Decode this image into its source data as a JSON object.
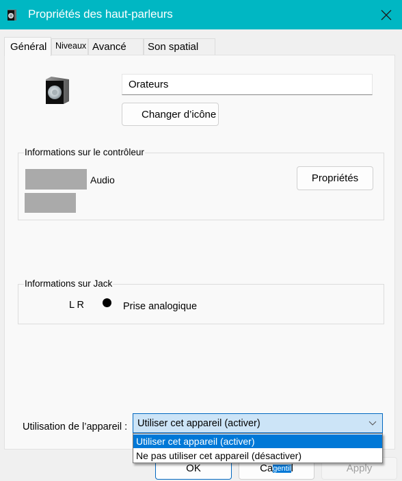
{
  "window": {
    "title": "Propriétés des haut-parleurs",
    "accent_color": "#00b7c3"
  },
  "tabs": [
    {
      "label": "Général",
      "active": true
    },
    {
      "label": "Niveaux",
      "active": false
    },
    {
      "label": "Avancé",
      "active": false
    },
    {
      "label": "Son spatial",
      "active": false
    }
  ],
  "general": {
    "device_icon": "speaker-icon",
    "device_name": "Orateurs",
    "change_icon_label": "Changer d’icône",
    "controller": {
      "title": "Informations sur le contrôleur",
      "line1_suffix": "Audio",
      "properties_label": "Propriétés"
    },
    "jack": {
      "title": "Informations sur Jack",
      "channels": "L R",
      "type": "Prise analogique"
    },
    "usage": {
      "label": "Utilisation de l’appareil :",
      "selected": "Utiliser cet appareil (activer)",
      "options": [
        "Utiliser cet appareil (activer)",
        "Ne pas utiliser cet appareil (désactiver)"
      ]
    }
  },
  "footer": {
    "ok_label": "OK",
    "cancel_prefix": "Ca",
    "cancel_overlay": "gentil",
    "apply_label": "Apply"
  }
}
